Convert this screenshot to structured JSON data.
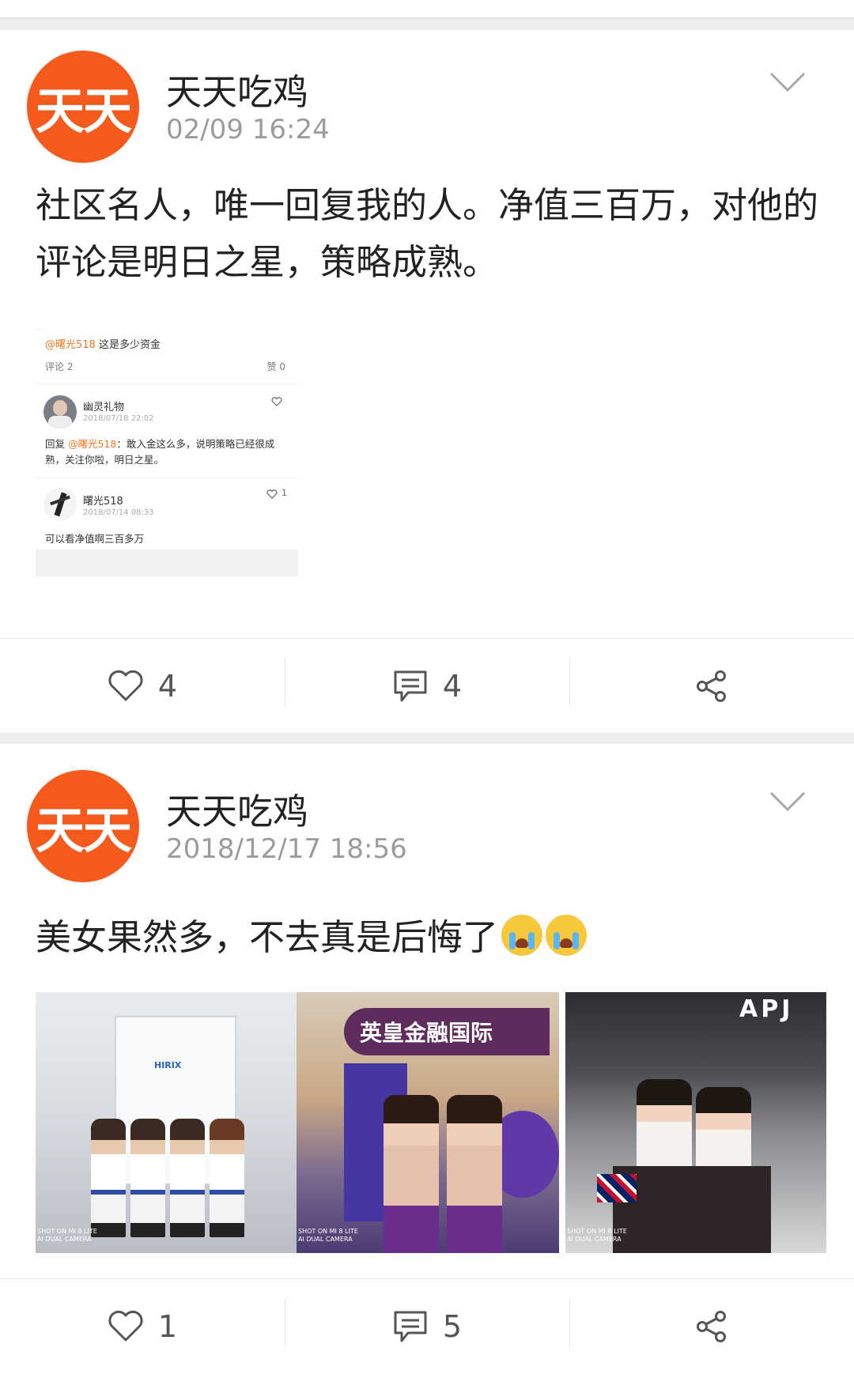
{
  "posts": [
    {
      "avatar_text": "天天",
      "author": "天天吃鸡",
      "time": "02/09 16:24",
      "text": "社区名人，唯一回复我的人。净值三百万，对他的评论是明日之星，策略成熟。",
      "embedded": {
        "mention": "@曙光518",
        "question": " 这是多少资金",
        "comment_label": "评论 2",
        "like_label": "赞 0",
        "comments": [
          {
            "name": "幽灵礼物",
            "time": "2018/07/18 22:02",
            "reply_prefix": "回复 ",
            "reply_mention": "@曙光518",
            "reply_text": "：敢入金这么多，说明策略已经很成熟，关注你啦，明日之星。",
            "likes": ""
          },
          {
            "name": "曙光518",
            "time": "2018/07/14 08:33",
            "text": "可以看净值啊三百多万",
            "likes": "1"
          }
        ]
      },
      "likes": "4",
      "comments": "4"
    },
    {
      "avatar_text": "天天",
      "author": "天天吃鸡",
      "time": "2018/12/17 18:56",
      "text": "美女果然多，不去真是后悔了",
      "photos": [
        {
          "caption": "SHOT ON MI 8 LITE\nAI DUAL CAMERA",
          "sign": "HIRIX"
        },
        {
          "caption": "SHOT ON MI 8 LITE\nAI DUAL CAMERA",
          "sign": "英皇金融国际"
        },
        {
          "caption": "SHOT ON MI 8 LITE\nAI DUAL CAMERA",
          "sign": "APJ"
        }
      ],
      "likes": "1",
      "comments": "5"
    }
  ],
  "colors": {
    "avatar": "#f35a1c",
    "mention": "#f47920",
    "separator": "#eeeeee",
    "meta": "#9b9b9b"
  },
  "icons": [
    "chevron-down-icon",
    "heart-icon",
    "comment-icon",
    "share-icon",
    "crying-emoji-icon"
  ]
}
